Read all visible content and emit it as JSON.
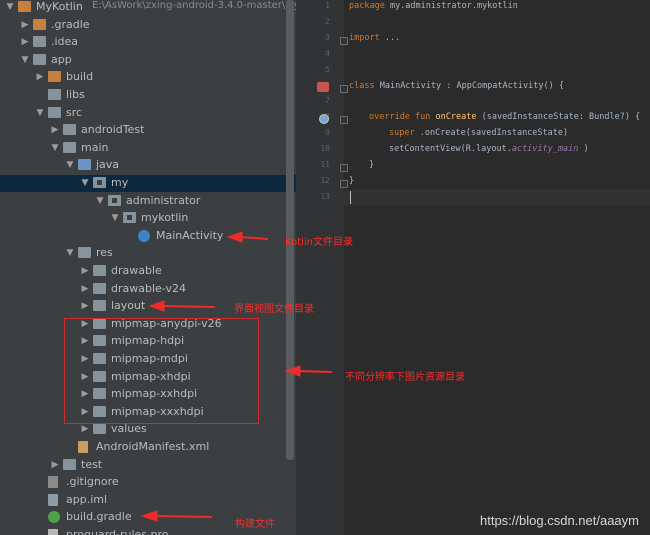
{
  "project_tree": {
    "rows": [
      {
        "indent": 0,
        "arrow": "▼",
        "icon": "folder-orange",
        "label": "MyKotlin",
        "suffix": "E:\\AsWork\\zxing-android-3.4.0-master\\My"
      },
      {
        "indent": 1,
        "arrow": "▶",
        "icon": "folder-orange",
        "label": ".gradle"
      },
      {
        "indent": 1,
        "arrow": "▶",
        "icon": "folder",
        "label": ".idea"
      },
      {
        "indent": 1,
        "arrow": "▼",
        "icon": "folder",
        "label": "app"
      },
      {
        "indent": 2,
        "arrow": "▶",
        "icon": "folder-orange",
        "label": "build"
      },
      {
        "indent": 2,
        "arrow": "",
        "icon": "folder",
        "label": "libs"
      },
      {
        "indent": 2,
        "arrow": "▼",
        "icon": "folder",
        "label": "src"
      },
      {
        "indent": 3,
        "arrow": "▶",
        "icon": "folder",
        "label": "androidTest"
      },
      {
        "indent": 3,
        "arrow": "▼",
        "icon": "folder",
        "label": "main"
      },
      {
        "indent": 4,
        "arrow": "▼",
        "icon": "folder-blue",
        "label": "java"
      },
      {
        "indent": 5,
        "arrow": "▼",
        "icon": "package",
        "label": "my",
        "selected": true
      },
      {
        "indent": 6,
        "arrow": "▼",
        "icon": "package",
        "label": "administrator"
      },
      {
        "indent": 7,
        "arrow": "▼",
        "icon": "package",
        "label": "mykotlin"
      },
      {
        "indent": 8,
        "arrow": "",
        "icon": "kotlin-class",
        "label": "MainActivity"
      },
      {
        "indent": 4,
        "arrow": "▼",
        "icon": "folder",
        "label": "res"
      },
      {
        "indent": 5,
        "arrow": "▶",
        "icon": "folder",
        "label": "drawable"
      },
      {
        "indent": 5,
        "arrow": "▶",
        "icon": "folder",
        "label": "drawable-v24"
      },
      {
        "indent": 5,
        "arrow": "▶",
        "icon": "folder",
        "label": "layout"
      },
      {
        "indent": 5,
        "arrow": "▶",
        "icon": "folder",
        "label": "mipmap-anydpi-v26"
      },
      {
        "indent": 5,
        "arrow": "▶",
        "icon": "folder",
        "label": "mipmap-hdpi"
      },
      {
        "indent": 5,
        "arrow": "▶",
        "icon": "folder",
        "label": "mipmap-mdpi"
      },
      {
        "indent": 5,
        "arrow": "▶",
        "icon": "folder",
        "label": "mipmap-xhdpi"
      },
      {
        "indent": 5,
        "arrow": "▶",
        "icon": "folder",
        "label": "mipmap-xxhdpi"
      },
      {
        "indent": 5,
        "arrow": "▶",
        "icon": "folder",
        "label": "mipmap-xxxhdpi"
      },
      {
        "indent": 5,
        "arrow": "▶",
        "icon": "folder",
        "label": "values"
      },
      {
        "indent": 4,
        "arrow": "",
        "icon": "xml-file",
        "label": "AndroidManifest.xml"
      },
      {
        "indent": 3,
        "arrow": "▶",
        "icon": "folder",
        "label": "test"
      },
      {
        "indent": 2,
        "arrow": "",
        "icon": "git-file",
        "label": ".gitignore"
      },
      {
        "indent": 2,
        "arrow": "",
        "icon": "iml-file",
        "label": "app.iml"
      },
      {
        "indent": 2,
        "arrow": "",
        "icon": "gradle-file",
        "label": "build.gradle"
      },
      {
        "indent": 2,
        "arrow": "",
        "icon": "file",
        "label": "proguard-rules.pro"
      }
    ]
  },
  "editor": {
    "line_numbers": [
      "1",
      "2",
      "3",
      "4",
      "5",
      "6",
      "7",
      "8",
      "9",
      "10",
      "11",
      "12",
      "13"
    ],
    "lines": [
      {
        "n": 1,
        "parts": [
          [
            "kw",
            "package"
          ],
          [
            "",
            "my.administrator.mykotlin"
          ]
        ]
      },
      {
        "n": 3,
        "parts": [
          [
            "kw",
            "import"
          ],
          [
            "",
            "..."
          ]
        ]
      },
      {
        "n": 6,
        "parts": [
          [
            "kw",
            "class"
          ],
          [
            "",
            "MainActivity : AppCompatActivity() {"
          ]
        ]
      },
      {
        "n": 8,
        "parts": [
          [
            "kw",
            "override fun"
          ],
          [
            "fn",
            "onCreate"
          ],
          [
            "",
            "(savedInstanceState: Bundle?) {"
          ]
        ]
      },
      {
        "n": 9,
        "parts": [
          [
            "kw",
            "super"
          ],
          [
            "",
            ".onCreate(savedInstanceState)"
          ]
        ]
      },
      {
        "n": 10,
        "parts": [
          [
            "",
            "setContentView(R.layout."
          ],
          [
            "it",
            "activity_main"
          ],
          [
            "",
            ")"
          ]
        ]
      },
      {
        "n": 11,
        "parts": [
          [
            "",
            "}"
          ]
        ]
      },
      {
        "n": 12,
        "parts": [
          [
            "",
            "}"
          ]
        ]
      }
    ]
  },
  "annotations": {
    "kotlin_dir": "Kotlin文件目录",
    "layout_dir": "界面视图文件目录",
    "mipmap_dir": "不同分辨率下图片资源目录",
    "build_file": "构建文件",
    "color": "#ff2a2a"
  },
  "watermark": "https://blog.csdn.net/aaaym"
}
